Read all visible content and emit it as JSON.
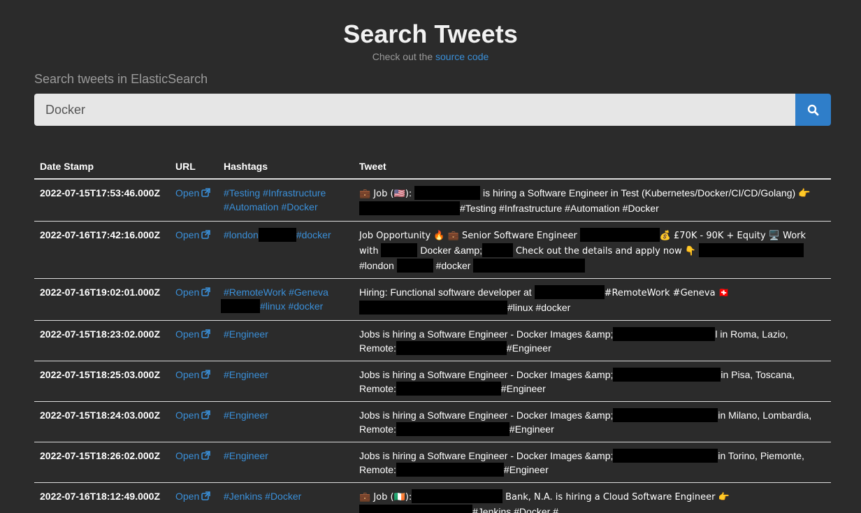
{
  "header": {
    "title": "Search Tweets",
    "subtitle_prefix": "Check out the",
    "subtitle_link": "source code"
  },
  "search": {
    "label": "Search tweets in ElasticSearch",
    "value": "Docker",
    "button_icon": "search-icon"
  },
  "table": {
    "columns": [
      "Date Stamp",
      "URL",
      "Hashtags",
      "Tweet"
    ],
    "open_label": "Open",
    "rows": [
      {
        "date": "2022-07-15T17:53:46.000Z",
        "tags": [
          "#Testing",
          "#Infrastructure",
          "#Automation",
          "#Docker"
        ],
        "tweet": [
          "💼 Job (🇺🇸):",
          "is hiring a Software Engineer in Test (Kubernetes/Docker/CI/CD/Golang) 👉",
          "#Testing #Infrastructure #Automation #Docker"
        ]
      },
      {
        "date": "2022-07-16T17:42:16.000Z",
        "tags": [
          "#london",
          "#docker"
        ],
        "tweet": [
          "Job Opportunity 🔥 💼 Senior Software Engineer",
          "💰 £70K - 90K + Equity 🖥️ Work with",
          "Docker &amp;",
          "Check out the details and apply now 👇",
          "#london",
          "#docker"
        ]
      },
      {
        "date": "2022-07-16T19:02:01.000Z",
        "tags": [
          "#RemoteWork",
          "#Geneva",
          "#linux",
          "#docker"
        ],
        "tweet": [
          "Hiring: Functional software developer at",
          "#RemoteWork #Geneva 🇨🇭",
          "#linux #docker"
        ]
      },
      {
        "date": "2022-07-15T18:23:02.000Z",
        "tags": [
          "#Engineer"
        ],
        "tweet": [
          "Jobs is hiring a Software Engineer - Docker Images &amp;",
          "l in Roma, Lazio,",
          "Remote:",
          "#Engineer"
        ]
      },
      {
        "date": "2022-07-15T18:25:03.000Z",
        "tags": [
          "#Engineer"
        ],
        "tweet": [
          "Jobs is hiring a Software Engineer - Docker Images &amp;",
          "in Pisa, Toscana,",
          "Remote:",
          "#Engineer"
        ]
      },
      {
        "date": "2022-07-15T18:24:03.000Z",
        "tags": [
          "#Engineer"
        ],
        "tweet": [
          "Jobs is hiring a Software Engineer - Docker Images &amp;",
          "in Milano, Lombardia,",
          "Remote:",
          "#Engineer"
        ]
      },
      {
        "date": "2022-07-15T18:26:02.000Z",
        "tags": [
          "#Engineer"
        ],
        "tweet": [
          "Jobs is hiring a Software Engineer - Docker Images &amp;",
          "in Torino, Piemonte,",
          "Remote:",
          "#Engineer"
        ]
      },
      {
        "date": "2022-07-16T18:12:49.000Z",
        "tags": [
          "#Jenkins",
          "#Docker"
        ],
        "tweet": [
          "💼 Job (🇮🇪):",
          "Bank, N.A. is hiring a Cloud Software Engineer 👉",
          "#Jenkins #Docker #…"
        ]
      }
    ]
  },
  "colors": {
    "background": "#2b2b2b",
    "link": "#3a8fd8",
    "button": "#2f7ec9",
    "input": "#e6e6e6",
    "redaction": "#000000"
  }
}
